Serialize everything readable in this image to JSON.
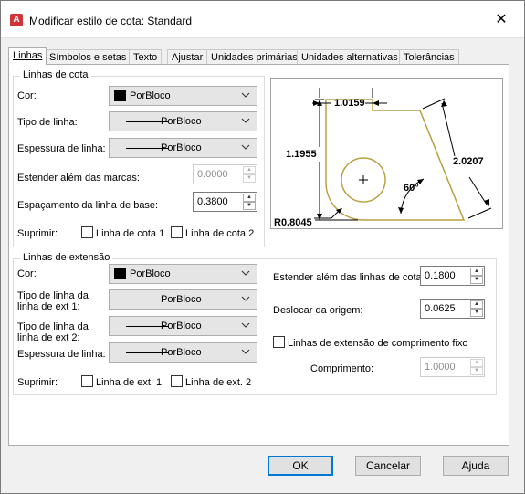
{
  "window": {
    "title": "Modificar estilo de cota: Standard",
    "app_icon_letter": "A",
    "close_glyph": "✕"
  },
  "tabs": [
    {
      "label": "Linhas",
      "active": true
    },
    {
      "label": "Símbolos e setas",
      "active": false
    },
    {
      "label": "Texto",
      "active": false
    },
    {
      "label": "Ajustar",
      "active": false
    },
    {
      "label": "Unidades primárias",
      "active": false
    },
    {
      "label": "Unidades alternativas",
      "active": false
    },
    {
      "label": "Tolerâncias",
      "active": false
    }
  ],
  "dim_lines": {
    "group_title": "Linhas de cota",
    "color_label": "Cor:",
    "color_value": "PorBloco",
    "color_swatch": "#000000",
    "linetype_label": "Tipo de linha:",
    "linetype_value": "PorBloco",
    "lineweight_label": "Espessura de linha:",
    "lineweight_value": "PorBloco",
    "extend_label": "Estender além das marcas:",
    "extend_value": "0.0000",
    "extend_enabled": false,
    "baseline_label": "Espaçamento da linha de base:",
    "baseline_value": "0.3800",
    "suppress_label": "Suprimir:",
    "suppress_1_label": "Linha de cota 1",
    "suppress_1_checked": false,
    "suppress_2_label": "Linha de cota 2",
    "suppress_2_checked": false
  },
  "ext_lines": {
    "group_title": "Linhas de extensão",
    "color_label": "Cor:",
    "color_value": "PorBloco",
    "color_swatch": "#000000",
    "linetype1_label_a": "Tipo de linha da",
    "linetype1_label_b": "linha de ext 1:",
    "linetype1_value": "PorBloco",
    "linetype2_label_a": "Tipo de linha da",
    "linetype2_label_b": "linha de ext 2:",
    "linetype2_value": "PorBloco",
    "lineweight_label": "Espessura de linha:",
    "lineweight_value": "PorBloco",
    "suppress_label": "Suprimir:",
    "suppress_1_label": "Linha de ext. 1",
    "suppress_1_checked": false,
    "suppress_2_label": "Linha de ext. 2",
    "suppress_2_checked": false,
    "extend_beyond_label": "Estender além das linhas de cota:",
    "extend_beyond_value": "0.1800",
    "offset_label": "Deslocar da origem:",
    "offset_value": "0.0625",
    "fixed_length_label": "Linhas de extensão de comprimento fixo",
    "fixed_length_checked": false,
    "length_label": "Comprimento:",
    "length_value": "1.0000",
    "length_enabled": false
  },
  "preview": {
    "dim_top": "1.0159",
    "dim_left": "1.1955",
    "dim_right": "2.0207",
    "dim_angle": "60°",
    "dim_radius": "R0.8045",
    "center_mark": "+",
    "outline_color": "#b8a040"
  },
  "buttons": {
    "ok": "OK",
    "cancel": "Cancelar",
    "help": "Ajuda"
  }
}
